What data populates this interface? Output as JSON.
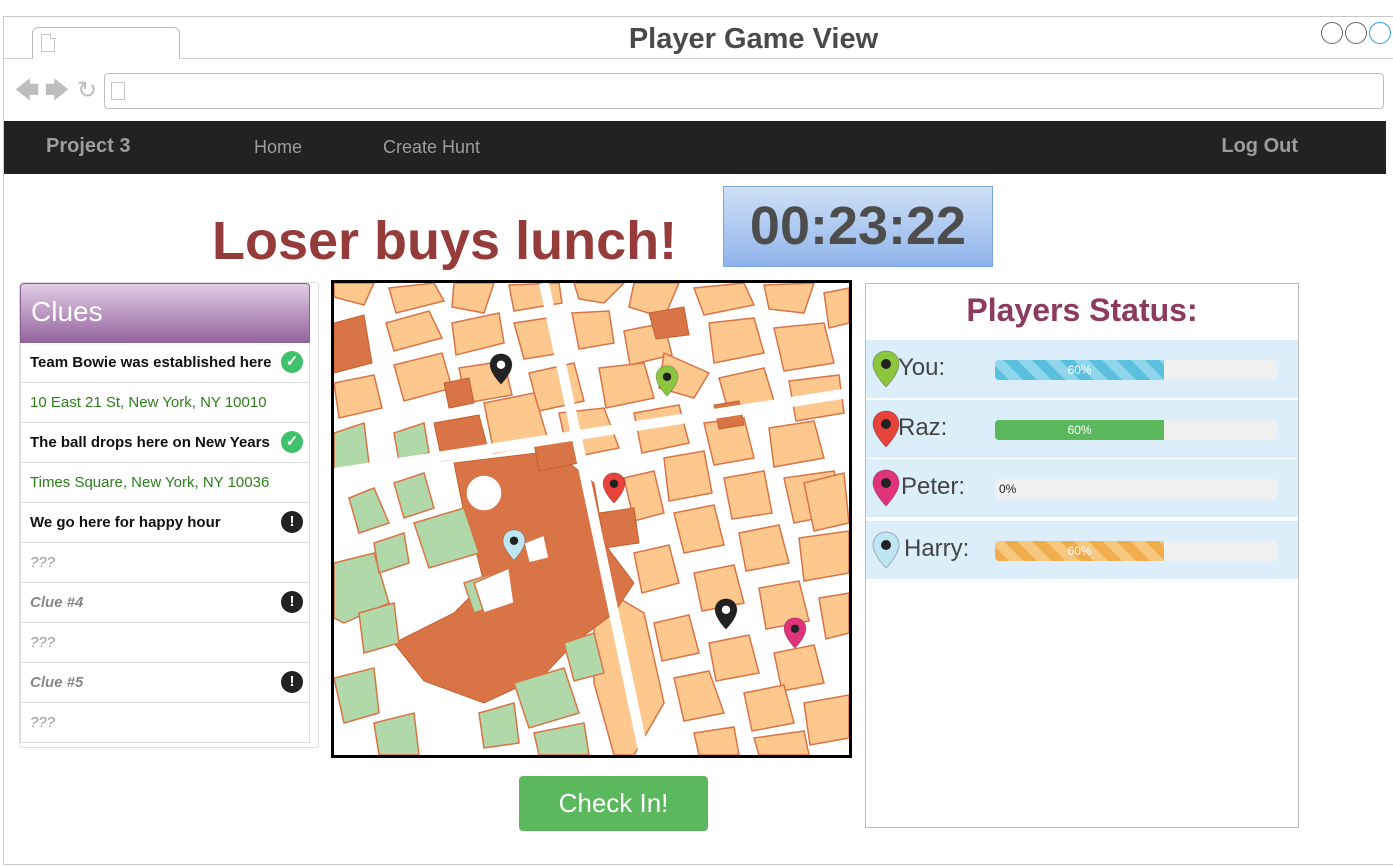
{
  "window": {
    "title": "Player Game View",
    "url": ""
  },
  "navbar": {
    "brand": "Project 3",
    "links": [
      "Home",
      "Create Hunt"
    ],
    "logout": "Log Out"
  },
  "header": {
    "headline": "Loser buys lunch!",
    "timer": "00:23:22"
  },
  "clues": {
    "title": "Clues",
    "items": [
      {
        "text": "Team Bowie was established here",
        "style": "bold",
        "status": "found"
      },
      {
        "text": "10 East 21 St, New York, NY 10010",
        "style": "addr"
      },
      {
        "text": "The ball drops here on New Years",
        "style": "bold",
        "status": "found"
      },
      {
        "text": "Times Square, New York, NY 10036",
        "style": "addr"
      },
      {
        "text": "We go here for happy hour",
        "style": "bold",
        "status": "pending"
      },
      {
        "text": "???",
        "style": "muted"
      },
      {
        "text": "Clue #4",
        "style": "muted-bold",
        "status": "pending"
      },
      {
        "text": "???",
        "style": "muted"
      },
      {
        "text": "Clue #5",
        "style": "muted-bold",
        "status": "pending"
      },
      {
        "text": "???",
        "style": "muted"
      }
    ],
    "icons": {
      "found": "check-circle-icon",
      "pending": "exclamation-circle-icon"
    }
  },
  "actions": {
    "check_in": "Check In!"
  },
  "players": {
    "title": "Players Status:",
    "list": [
      {
        "name": "You:",
        "progress": 60,
        "label": "60%",
        "variant": "info",
        "pin_color": "#8cc63f"
      },
      {
        "name": "Raz:",
        "progress": 60,
        "label": "60%",
        "variant": "success",
        "pin_color": "#e8433b"
      },
      {
        "name": "Peter:",
        "progress": 0,
        "label": "0%",
        "variant": "none",
        "pin_color": "#e0337a"
      },
      {
        "name": "Harry:",
        "progress": 60,
        "label": "60%",
        "variant": "warning",
        "pin_color": "#bfe4f2"
      }
    ]
  },
  "map": {
    "pins": [
      {
        "player": "You",
        "color": "#8cc63f"
      },
      {
        "player": "Raz",
        "color": "#e8433b"
      },
      {
        "player": "Peter",
        "color": "#e0337a"
      },
      {
        "player": "Harry",
        "color": "#bfe4f2"
      },
      {
        "player": "clue",
        "color": "#222222"
      },
      {
        "player": "clue",
        "color": "#222222"
      }
    ]
  },
  "colors": {
    "accent_headline": "#953b39",
    "clues_header": "#94649e",
    "players_title": "#8c3a5f",
    "check_in": "#5cb85c",
    "block": "#fdc88d",
    "block_dark": "#d97446",
    "park": "#b1d8a8"
  }
}
